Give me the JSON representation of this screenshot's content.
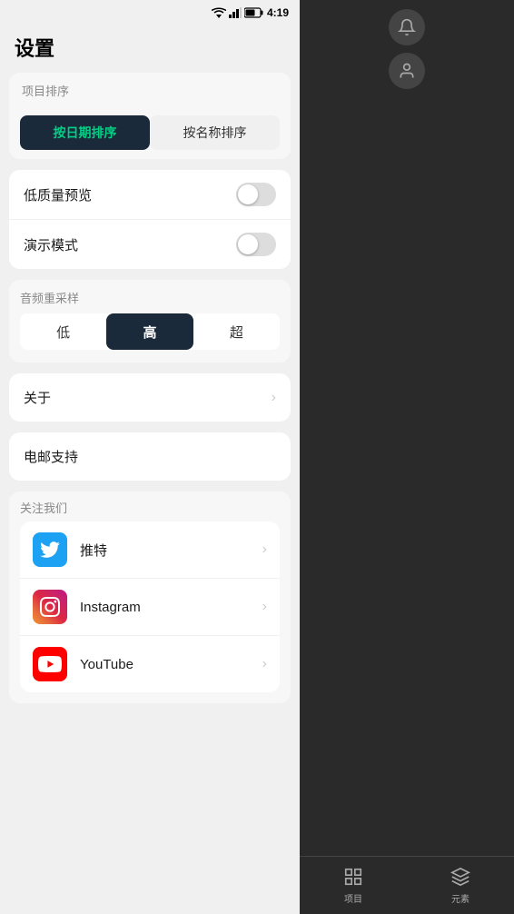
{
  "statusBar": {
    "time": "4:19"
  },
  "settings": {
    "title": "设置",
    "sortSection": {
      "label": "项目排序",
      "byDate": "按日期排序",
      "byName": "按名称排序",
      "activeIndex": 0
    },
    "toggles": [
      {
        "label": "低质量预览",
        "enabled": false
      },
      {
        "label": "演示模式",
        "enabled": false
      }
    ],
    "audioResample": {
      "label": "音频重采样",
      "options": [
        "低",
        "高",
        "超"
      ],
      "activeIndex": 1
    },
    "about": {
      "label": "关于"
    },
    "emailSupport": {
      "label": "电邮支持"
    },
    "followUs": {
      "label": "关注我们",
      "items": [
        {
          "name": "推特",
          "platform": "twitter"
        },
        {
          "name": "Instagram",
          "platform": "instagram"
        },
        {
          "name": "YouTube",
          "platform": "youtube"
        }
      ]
    }
  },
  "bottomNav": {
    "items": [
      {
        "label": "项目",
        "icon": "project-icon"
      },
      {
        "label": "元素",
        "icon": "elements-icon"
      }
    ]
  }
}
